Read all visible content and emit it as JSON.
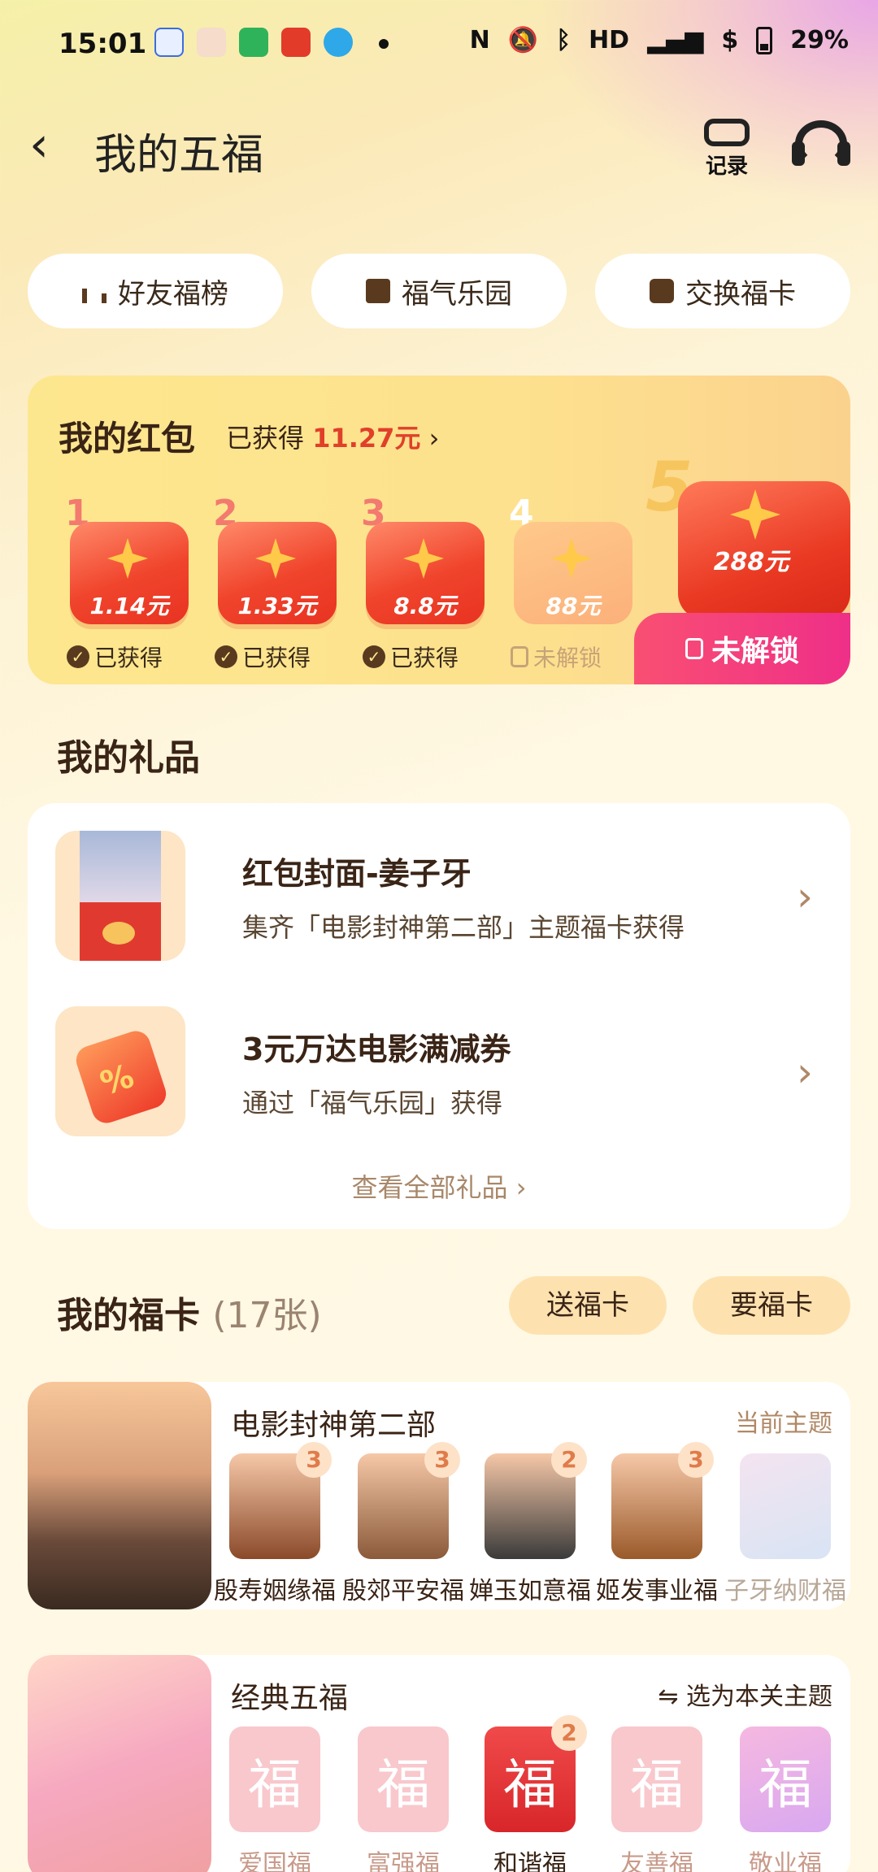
{
  "status_bar": {
    "time": "15:01",
    "battery": "29%"
  },
  "header": {
    "title": "我的五福",
    "records_label": "记录"
  },
  "quick_links": [
    "好友福榜",
    "福气乐园",
    "交换福卡"
  ],
  "red_packet": {
    "title": "我的红包",
    "earned_prefix": "已获得",
    "earned_amount": "11.27元",
    "steps": [
      {
        "num": "1",
        "amount": "1.14元",
        "status": "已获得"
      },
      {
        "num": "2",
        "amount": "1.33元",
        "status": "已获得"
      },
      {
        "num": "3",
        "amount": "8.8元",
        "status": "已获得"
      },
      {
        "num": "4",
        "amount": "88元",
        "status": "未解锁"
      },
      {
        "num": "5",
        "amount": "288元",
        "status": "未解锁"
      }
    ]
  },
  "gifts": {
    "title": "我的礼品",
    "items": [
      {
        "title": "红包封面-姜子牙",
        "subtitle": "集齐「电影封神第二部」主题福卡获得"
      },
      {
        "title": "3元万达电影满减券",
        "subtitle": "通过「福气乐园」获得"
      }
    ],
    "view_all": "查看全部礼品"
  },
  "fuka": {
    "title": "我的福卡",
    "count": "(17张)",
    "send_button": "送福卡",
    "ask_button": "要福卡",
    "themes": [
      {
        "name": "电影封神第二部",
        "tag": "当前主题",
        "cards": [
          {
            "label": "殷寿姻缘福",
            "count": "3"
          },
          {
            "label": "殷郊平安福",
            "count": "3"
          },
          {
            "label": "婵玉如意福",
            "count": "2"
          },
          {
            "label": "姬发事业福",
            "count": "3"
          },
          {
            "label": "子牙纳财福",
            "count": ""
          }
        ]
      },
      {
        "name": "经典五福",
        "tag": "⇋ 选为本关主题",
        "cards": [
          {
            "label": "爱国福",
            "count": "",
            "glyph": "福"
          },
          {
            "label": "富强福",
            "count": "",
            "glyph": "福"
          },
          {
            "label": "和谐福",
            "count": "2",
            "glyph": "福"
          },
          {
            "label": "友善福",
            "count": "",
            "glyph": "福"
          },
          {
            "label": "敬业福",
            "count": "",
            "glyph": "福"
          }
        ]
      }
    ]
  },
  "colors": {
    "accent_red": "#e0402a",
    "unlock_pink": "#ef2f88",
    "packet_yellow": "#fde78e"
  }
}
